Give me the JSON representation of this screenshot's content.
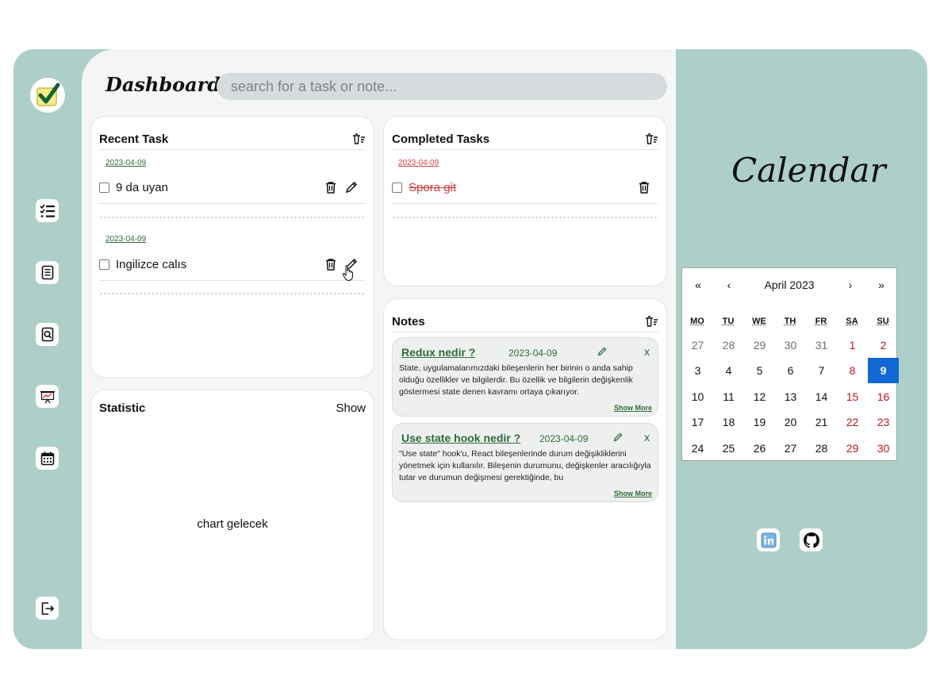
{
  "sidebar": {
    "items": [
      {
        "name": "task-list-icon"
      },
      {
        "name": "notes-icon"
      },
      {
        "name": "search-document-icon"
      },
      {
        "name": "presentation-chart-icon"
      },
      {
        "name": "calendar-icon"
      }
    ],
    "logout_icon": "logout-icon"
  },
  "header": {
    "title": "Dashboard",
    "search_placeholder": "search for a task or note..."
  },
  "recent_tasks": {
    "title": "Recent Task",
    "items": [
      {
        "date": "2023-04-09",
        "text": "9 da uyan"
      },
      {
        "date": "2023-04-09",
        "text": "Ingilizce calıs"
      }
    ]
  },
  "completed_tasks": {
    "title": "Completed Tasks",
    "items": [
      {
        "date": "2023-04-09",
        "text": "Spora git"
      }
    ]
  },
  "statistic": {
    "title": "Statistic",
    "show_label": "Show",
    "placeholder": "chart gelecek"
  },
  "notes": {
    "title": "Notes",
    "show_more": "Show More",
    "close": "x",
    "items": [
      {
        "title": "Redux nedir ?",
        "date": "2023-04-09",
        "body": "State, uygulamalarımızdaki bileşenlerin her birinin o anda sahip olduğu özellikler ve bilgilerdir. Bu özellik ve bilgilerin değişkenlik göstermesi state denen kavramı ortaya çıkarıyor."
      },
      {
        "title": "Use state hook nedir ?",
        "date": "2023-04-09",
        "body": "\"Use state\" hook'u, React bileşenlerinde durum değişikliklerini yönetmek için kullanılır. Bileşenin durumunu, değişkenler aracılığıyla tutar ve durumun değişmesi gerektiğinde, bu"
      }
    ]
  },
  "calendar": {
    "title": "Calendar",
    "month_label": "April 2023",
    "nav": {
      "prev_year": "«",
      "prev": "‹",
      "next": "›",
      "next_year": "»"
    },
    "weekdays": [
      "MO",
      "TU",
      "WE",
      "TH",
      "FR",
      "SA",
      "SU"
    ],
    "weeks": [
      [
        "27",
        "28",
        "29",
        "30",
        "31",
        "1",
        "2"
      ],
      [
        "3",
        "4",
        "5",
        "6",
        "7",
        "8",
        "9"
      ],
      [
        "10",
        "11",
        "12",
        "13",
        "14",
        "15",
        "16"
      ],
      [
        "17",
        "18",
        "19",
        "20",
        "21",
        "22",
        "23"
      ],
      [
        "24",
        "25",
        "26",
        "27",
        "28",
        "29",
        "30"
      ]
    ],
    "selected_day": "9",
    "selected_color": "#1167d3",
    "weekend_color": "#c0151d"
  },
  "social": [
    "linkedin-icon",
    "github-icon"
  ],
  "colors": {
    "background": "#adcfc8",
    "main_panel": "#f5f5f5",
    "accent_green": "#2e6b3b",
    "completed_red": "#d13b3b"
  }
}
